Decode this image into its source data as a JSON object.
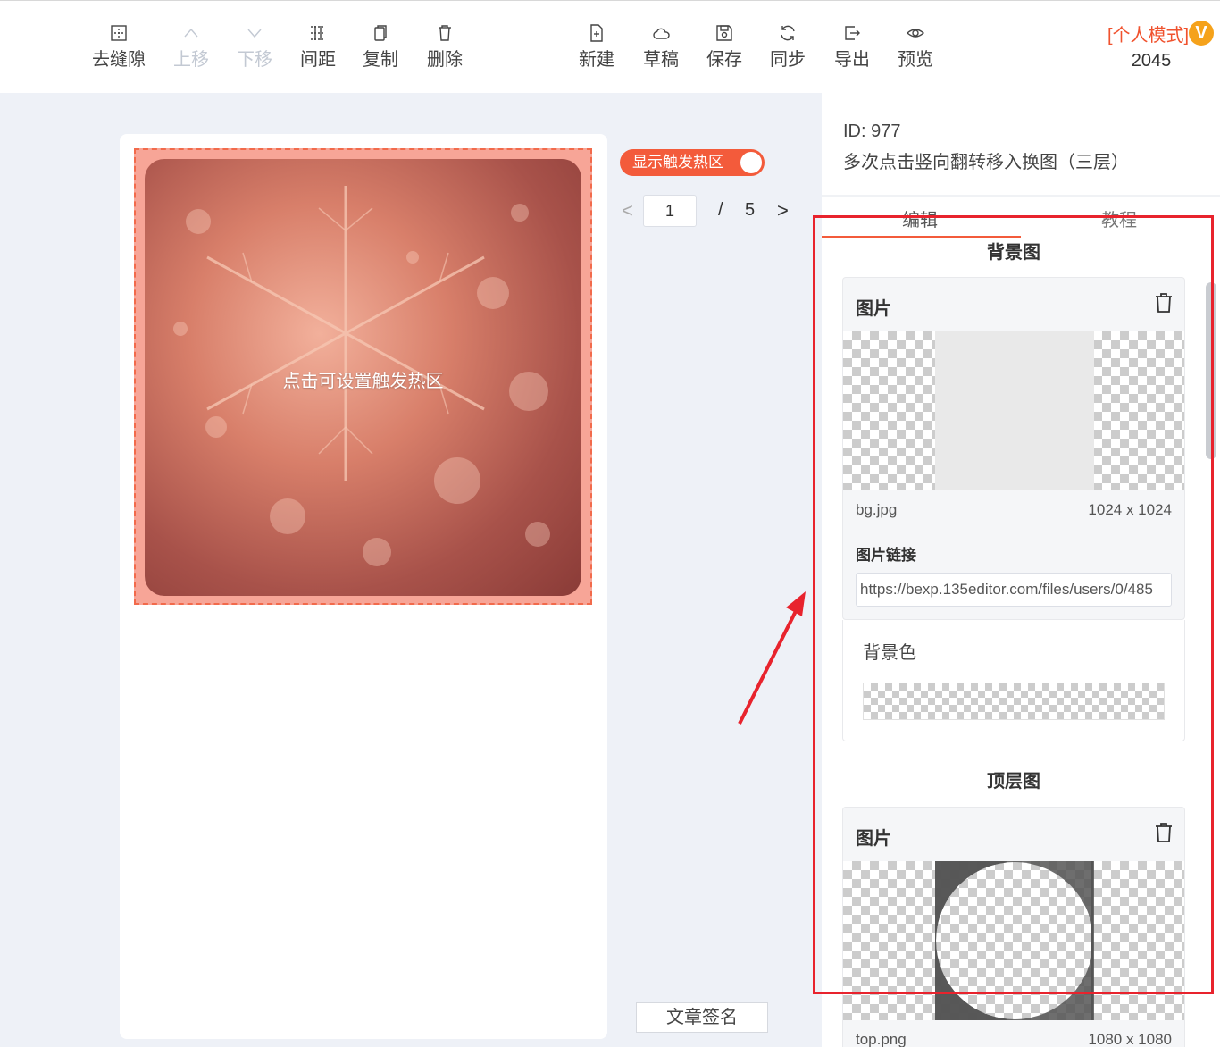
{
  "toolbar": {
    "tools_left": [
      {
        "label": "去缝隙",
        "icon": "gap-remove-icon",
        "disabled": false
      },
      {
        "label": "上移",
        "icon": "chevron-up-icon",
        "disabled": true
      },
      {
        "label": "下移",
        "icon": "chevron-down-icon",
        "disabled": true
      },
      {
        "label": "间距",
        "icon": "spacing-icon",
        "disabled": false
      },
      {
        "label": "复制",
        "icon": "copy-icon",
        "disabled": false
      },
      {
        "label": "删除",
        "icon": "trash-icon",
        "disabled": false
      }
    ],
    "tools_right": [
      {
        "label": "新建",
        "icon": "new-file-icon"
      },
      {
        "label": "草稿",
        "icon": "cloud-icon"
      },
      {
        "label": "保存",
        "icon": "save-icon"
      },
      {
        "label": "同步",
        "icon": "sync-icon"
      },
      {
        "label": "导出",
        "icon": "export-icon"
      },
      {
        "label": "预览",
        "icon": "eye-icon"
      }
    ],
    "mode_label": "[个人模式]",
    "vip_badge": "V",
    "count": "2045"
  },
  "canvas": {
    "hotzone_label": "点击可设置触发热区"
  },
  "toggle": {
    "label": "显示触发热区",
    "on": true
  },
  "pager": {
    "prev": "<",
    "current": "1",
    "separator": "/",
    "total": "5",
    "next": ">"
  },
  "sign_button": "文章签名",
  "panel": {
    "id_text": "ID: 977",
    "name": "多次点击竖向翻转移入换图（三层）",
    "tabs": [
      "编辑",
      "教程"
    ],
    "background_section": {
      "title": "背景图",
      "card_title": "图片",
      "file_name": "bg.jpg",
      "file_size": "1024 x 1024",
      "link_label": "图片链接",
      "link_value": "https://bexp.135editor.com/files/users/0/485"
    },
    "bgcolor_label": "背景色",
    "top_section": {
      "title": "顶层图",
      "card_title": "图片",
      "file_name": "top.png",
      "file_size": "1080 x 1080"
    }
  },
  "colors": {
    "accent": "#f35b3b",
    "annotation": "#e8232d",
    "vip": "#f5a21b"
  }
}
